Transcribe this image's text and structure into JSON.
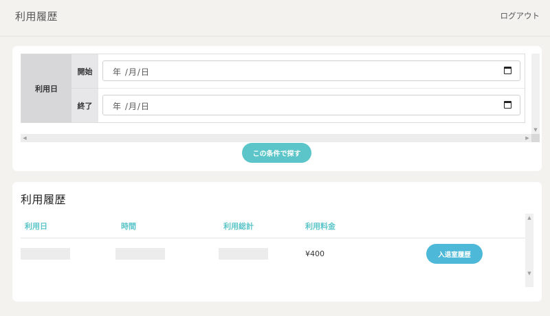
{
  "header": {
    "title": "利用履歴",
    "logout_label": "ログアウト"
  },
  "filter": {
    "date_label": "利用日",
    "start_label": "開始",
    "end_label": "終了",
    "start_value": "年 /月/日",
    "end_value": "年 /月/日",
    "search_button_label": "この条件で探す"
  },
  "history": {
    "title": "利用履歴",
    "columns": [
      "利用日",
      "時間",
      "利用総計",
      "利用料金"
    ],
    "rows": [
      {
        "date": "",
        "time": "",
        "total": "",
        "fee": "¥400",
        "button_label": "入退室履歴"
      }
    ]
  },
  "colors": {
    "accent": "#5bc5c9",
    "history_button": "#4db8d8",
    "background": "#f3f2ef"
  },
  "icons": [
    "calendar-icon",
    "scroll-left-arrow-icon",
    "scroll-right-arrow-icon",
    "scroll-up-arrow-icon",
    "scroll-down-arrow-icon"
  ]
}
